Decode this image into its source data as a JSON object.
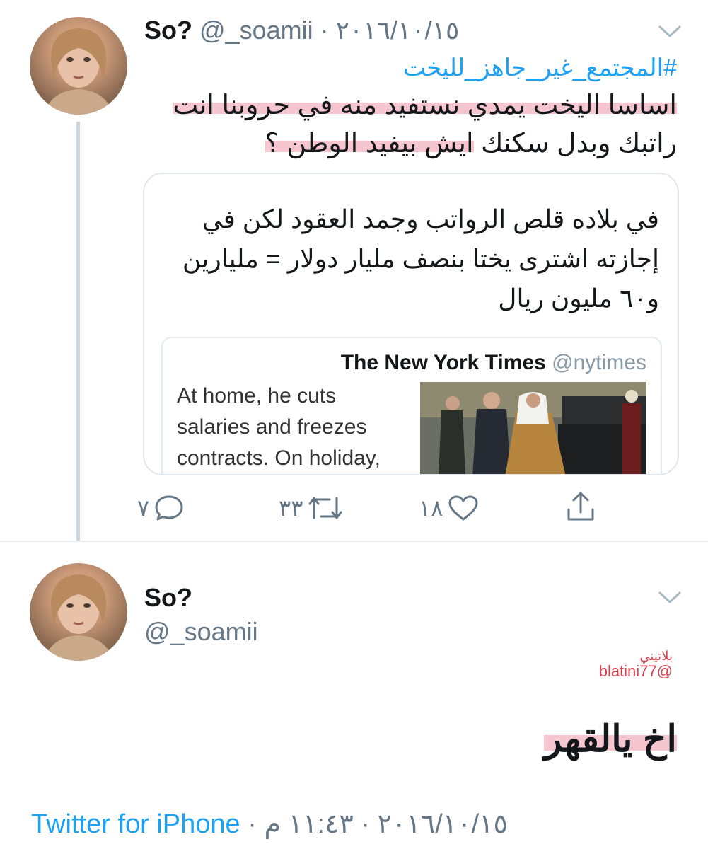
{
  "tweet1": {
    "name": "So?",
    "handle": "@_soamii",
    "separator": "·",
    "date": "٢٠١٦/١٠/١٥",
    "hashtag": "#المجتمع_غير_جاهز_لليخت",
    "text_line1": "اساسا اليخت يمدي نستفيد منه في حروبنا انت",
    "text_line2_plain": "راتبك وبدل سكنك ",
    "text_line2_hl": "ايش بيفيد الوطن ؟",
    "quote": {
      "line1": "في بلاده قلص الرواتب وجمد العقود لكن في",
      "line2": "إجازته اشترى يختا بنصف مليار دولار = مليارين",
      "line3": "و٦٠ مليون ريال",
      "card": {
        "source_name": "The New York Times",
        "source_handle": "@nytimes",
        "text_line1": "At home, he cuts",
        "text_line2": "salaries and freezes",
        "text_line3": "contracts. On holiday,"
      }
    },
    "actions": {
      "replies": "٧",
      "retweets": "٣٣",
      "likes": "١٨"
    }
  },
  "tweet2": {
    "name": "So?",
    "handle": "@_soamii",
    "watermark_name": "بلاتيني",
    "watermark_handle": "@blatini77",
    "text": "اخ يالقهر",
    "footer": {
      "source": "Twitter for iPhone",
      "separator": "·",
      "date": "٢٠١٦/١٠/١٥",
      "time": "١١:٤٣ م"
    }
  },
  "colors": {
    "link": "#1da1f2",
    "secondary": "#657786",
    "highlight": "#e98096"
  },
  "icons": [
    "chevron-down-icon",
    "reply-icon",
    "retweet-icon",
    "like-icon",
    "share-icon"
  ]
}
